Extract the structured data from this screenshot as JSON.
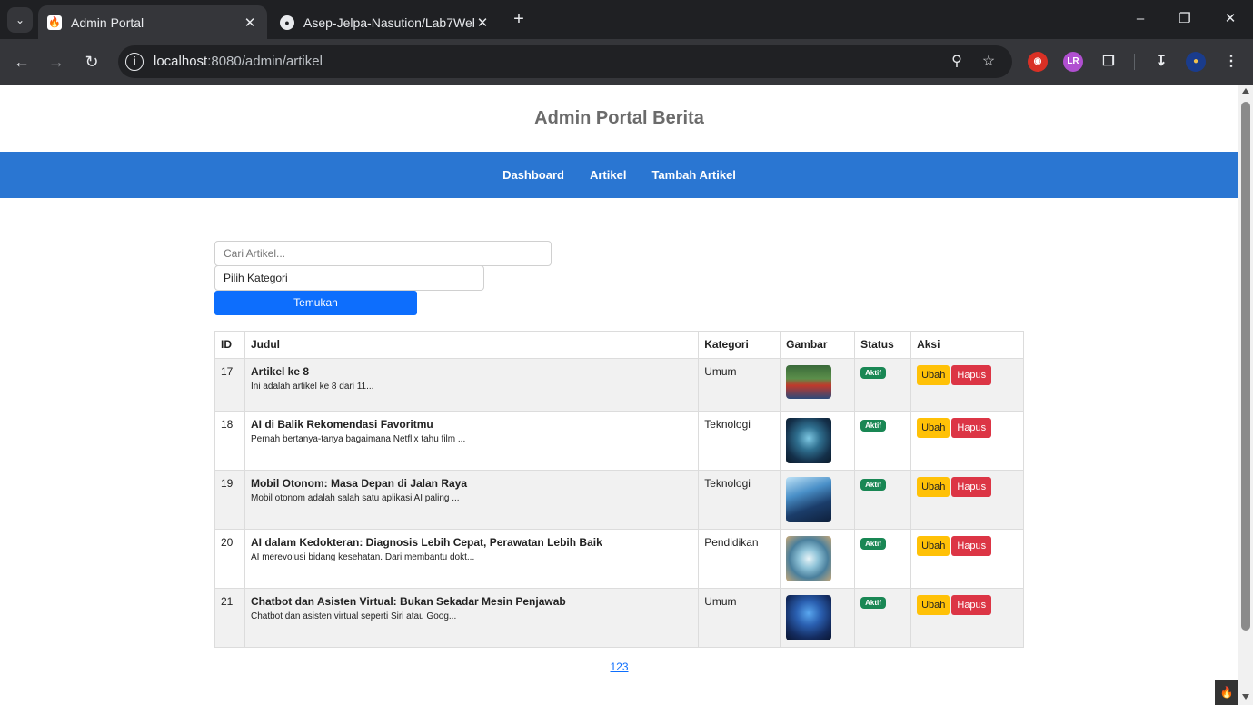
{
  "browser": {
    "tabs": [
      {
        "title": "Admin Portal",
        "icon": "codeigniter-icon",
        "active": true
      },
      {
        "title": "Asep-Jelpa-Nasution/Lab7Web",
        "icon": "github-icon",
        "active": false
      }
    ],
    "url_host": "localhost",
    "url_path": ":8080/admin/artikel"
  },
  "site": {
    "title": "Admin Portal Berita",
    "nav": [
      "Dashboard",
      "Artikel",
      "Tambah Artikel"
    ]
  },
  "filter": {
    "search_placeholder": "Cari Artikel...",
    "category_selected": "Pilih Kategori",
    "submit_label": "Temukan"
  },
  "table": {
    "headers": [
      "ID",
      "Judul",
      "Kategori",
      "Gambar",
      "Status",
      "Aksi"
    ],
    "rows": [
      {
        "id": "17",
        "title": "Artikel ke 8",
        "excerpt": "Ini adalah artikel ke 8 dari 11...",
        "category": "Umum",
        "status": "Aktif",
        "edit": "Ubah",
        "delete": "Hapus"
      },
      {
        "id": "18",
        "title": "AI di Balik Rekomendasi Favoritmu",
        "excerpt": "Pernah bertanya-tanya bagaimana Netflix tahu film ...",
        "category": "Teknologi",
        "status": "Aktif",
        "edit": "Ubah",
        "delete": "Hapus"
      },
      {
        "id": "19",
        "title": "Mobil Otonom: Masa Depan di Jalan Raya",
        "excerpt": "Mobil otonom adalah salah satu aplikasi AI paling ...",
        "category": "Teknologi",
        "status": "Aktif",
        "edit": "Ubah",
        "delete": "Hapus"
      },
      {
        "id": "20",
        "title": "AI dalam Kedokteran: Diagnosis Lebih Cepat, Perawatan Lebih Baik",
        "excerpt": "AI merevolusi bidang kesehatan. Dari membantu dokt...",
        "category": "Pendidikan",
        "status": "Aktif",
        "edit": "Ubah",
        "delete": "Hapus"
      },
      {
        "id": "21",
        "title": "Chatbot dan Asisten Virtual: Bukan Sekadar Mesin Penjawab",
        "excerpt": "Chatbot dan asisten virtual seperti Siri atau Goog...",
        "category": "Umum",
        "status": "Aktif",
        "edit": "Ubah",
        "delete": "Hapus"
      }
    ]
  },
  "pagination": {
    "label": "123"
  },
  "colors": {
    "nav": "#2a76d2",
    "primary": "#0d6efd",
    "success": "#198754",
    "warning": "#ffc107",
    "danger": "#dc3545"
  }
}
